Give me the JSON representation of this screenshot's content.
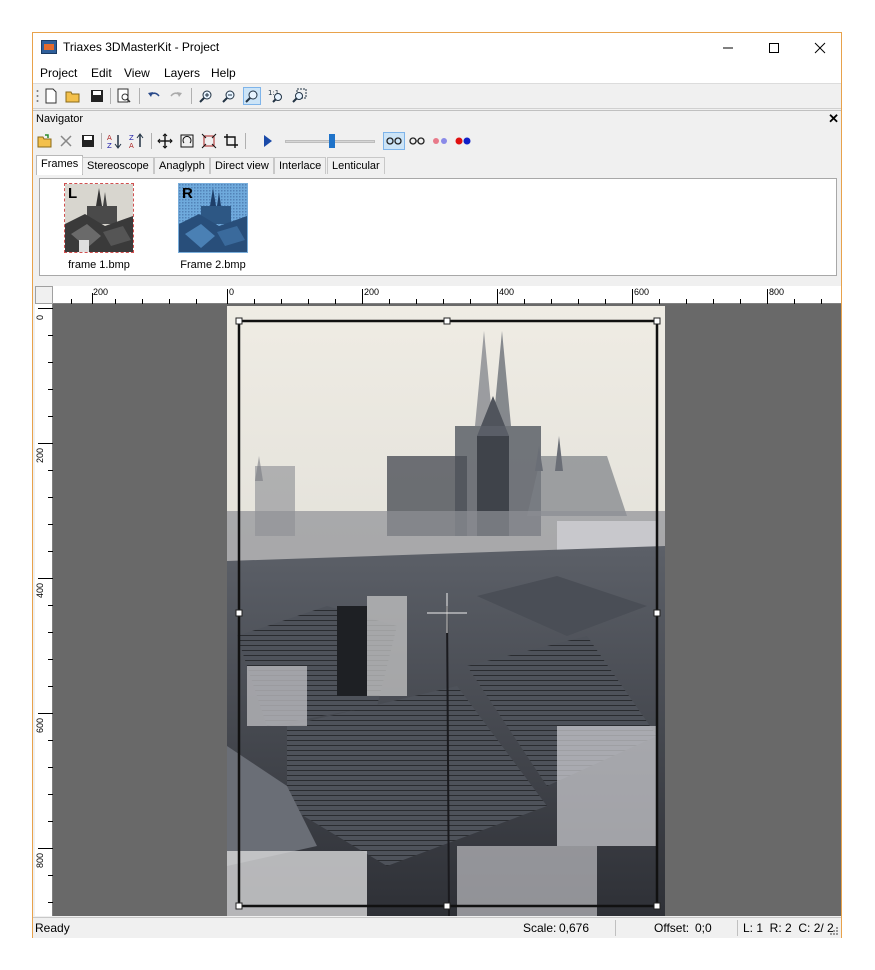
{
  "window": {
    "title": "Triaxes 3DMasterKit - Project",
    "controls": [
      "—",
      "☐",
      "✕"
    ]
  },
  "menu": {
    "items": [
      "Project",
      "Edit",
      "View",
      "Layers",
      "Help"
    ]
  },
  "navigator": {
    "title": "Navigator",
    "close": "✕"
  },
  "tabs": [
    "Frames",
    "Stereoscope",
    "Anaglyph",
    "Direct view",
    "Interlace",
    "Lenticular"
  ],
  "frames": [
    {
      "name": "frame 1.bmp",
      "letter": "L"
    },
    {
      "name": "Frame 2.bmp",
      "letter": "R"
    }
  ],
  "ruler": {
    "h_labels": [
      "200",
      "0",
      "200",
      "400",
      "600",
      "800"
    ],
    "v_labels": [
      "0",
      "200",
      "400",
      "600",
      "800"
    ]
  },
  "status": {
    "state": "Ready",
    "scale_label": "Scale:",
    "scale_value": "0,676",
    "offset_label": "Offset:",
    "offset_value": "0;0",
    "frames_info": "L: 1  R: 2  C: 2/ 2"
  }
}
